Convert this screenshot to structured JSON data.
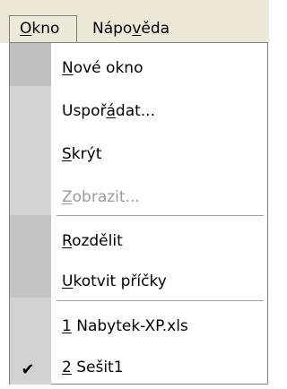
{
  "menubar": {
    "items": [
      {
        "label_u": "O",
        "label_rest": "kno"
      },
      {
        "label_pre": "Nápo",
        "label_u": "v",
        "label_rest": "ěda"
      }
    ]
  },
  "menu": {
    "items": [
      {
        "pre": "",
        "u": "N",
        "post": "ové okno"
      },
      {
        "pre": "Uspoř",
        "u": "á",
        "post": "dat..."
      },
      {
        "pre": "",
        "u": "S",
        "post": "krýt"
      },
      {
        "pre": "",
        "u": "Z",
        "post": "obrazit..."
      },
      {
        "pre": "",
        "u": "R",
        "post": "ozdělit"
      },
      {
        "pre": "",
        "u": "U",
        "post": "kotvit příčky"
      },
      {
        "pre": "",
        "u": "1",
        "post": " Nabytek-XP.xls"
      },
      {
        "pre": "",
        "u": "2",
        "post": " Sešit1"
      }
    ],
    "check_glyph": "✔"
  }
}
